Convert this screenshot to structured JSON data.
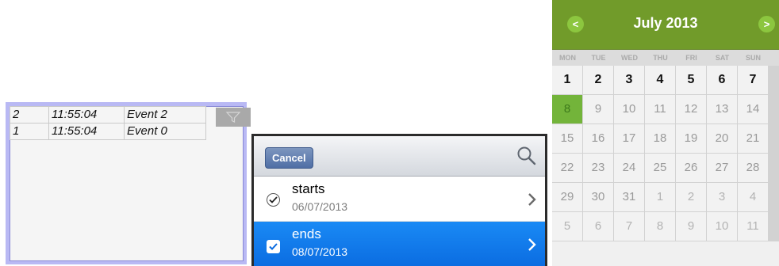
{
  "event_log": {
    "rows": [
      {
        "id": "2",
        "time": "11:55:04",
        "event": "Event 2"
      },
      {
        "id": "1",
        "time": "11:55:04",
        "event": "Event 0"
      }
    ],
    "filter_icon": "filter-icon"
  },
  "picker_list": {
    "cancel_label": "Cancel",
    "search_icon": "search-icon",
    "items": [
      {
        "title": "starts",
        "subtitle": "06/07/2013",
        "checked": true,
        "selected": false
      },
      {
        "title": "ends",
        "subtitle": "08/07/2013",
        "checked": true,
        "selected": true
      }
    ]
  },
  "calendar": {
    "month_label": "July 2013",
    "prev_label": "<",
    "next_label": ">",
    "weekdays": [
      "MON",
      "TUE",
      "WED",
      "THU",
      "FRI",
      "SAT",
      "SUN"
    ],
    "weeks": [
      [
        "1",
        "2",
        "3",
        "4",
        "5",
        "6",
        "7"
      ],
      [
        "8",
        "9",
        "10",
        "11",
        "12",
        "13",
        "14"
      ],
      [
        "15",
        "16",
        "17",
        "18",
        "19",
        "20",
        "21"
      ],
      [
        "22",
        "23",
        "24",
        "25",
        "26",
        "27",
        "28"
      ],
      [
        "29",
        "30",
        "31",
        "1",
        "2",
        "3",
        "4"
      ],
      [
        "5",
        "6",
        "7",
        "8",
        "9",
        "10",
        "11"
      ]
    ],
    "selected_day": "8",
    "colors": {
      "header": "#719b2a",
      "nav": "#8cc63f",
      "selected": "#73b43a"
    }
  }
}
